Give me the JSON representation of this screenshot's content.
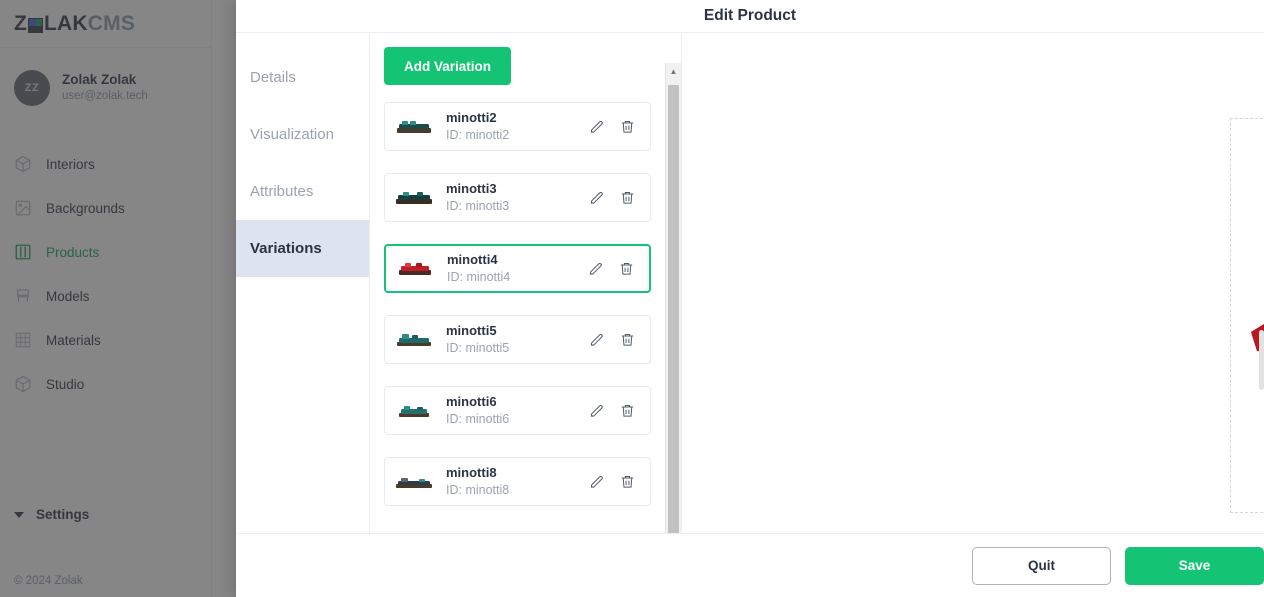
{
  "sidebar": {
    "logo": {
      "before": "Z",
      "mark": "logo-grid-icon",
      "after": "LAK",
      "suffix": "CMS"
    },
    "user": {
      "initials": "ZZ",
      "name": "Zolak Zolak",
      "email": "user@zolak.tech"
    },
    "items": [
      {
        "label": "Interiors",
        "icon": "cube-icon",
        "active": false
      },
      {
        "label": "Backgrounds",
        "icon": "image-icon",
        "active": false
      },
      {
        "label": "Products",
        "icon": "columns-icon",
        "active": true
      },
      {
        "label": "Models",
        "icon": "chair-icon",
        "active": false
      },
      {
        "label": "Materials",
        "icon": "grid-icon",
        "active": false
      },
      {
        "label": "Studio",
        "icon": "cube-icon",
        "active": false
      }
    ],
    "settings_label": "Settings",
    "copyright": "© 2024 Zolak"
  },
  "modal": {
    "title": "Edit Product",
    "tabs": [
      {
        "label": "Details",
        "active": false
      },
      {
        "label": "Visualization",
        "active": false
      },
      {
        "label": "Attributes",
        "active": false
      },
      {
        "label": "Variations",
        "active": true
      }
    ],
    "add_variation_label": "Add Variation",
    "id_prefix": "ID: ",
    "variations": [
      {
        "name": "minotti2",
        "id": "ID: minotti2",
        "selected": false,
        "thumb_color": "#1f7a78"
      },
      {
        "name": "minotti3",
        "id": "ID: minotti3",
        "selected": false,
        "thumb_color": "#1f7a78"
      },
      {
        "name": "minotti4",
        "id": "ID: minotti4",
        "selected": true,
        "thumb_color": "#c11f28"
      },
      {
        "name": "minotti5",
        "id": "ID: minotti5",
        "selected": false,
        "thumb_color": "#2a8d8a"
      },
      {
        "name": "minotti6",
        "id": "ID: minotti6",
        "selected": false,
        "thumb_color": "#2a8d8a"
      },
      {
        "name": "minotti8",
        "id": "ID: minotti8",
        "selected": false,
        "thumb_color": "#2a8d8a"
      }
    ],
    "preview": {
      "fullscreen_icon": "fullscreen-expand-icon",
      "model_name": "minotti4",
      "sofa_body_color": "#cf1420",
      "sofa_pillow_color": "#3fa9a5",
      "sofa_base_color": "#6b4a2a"
    },
    "quit_label": "Quit",
    "save_label": "Save"
  },
  "colors": {
    "accent_green": "#14c474",
    "active_tab_bg": "#dde3ef",
    "text_dark": "#2b3445",
    "text_muted": "#9aa3b2"
  }
}
